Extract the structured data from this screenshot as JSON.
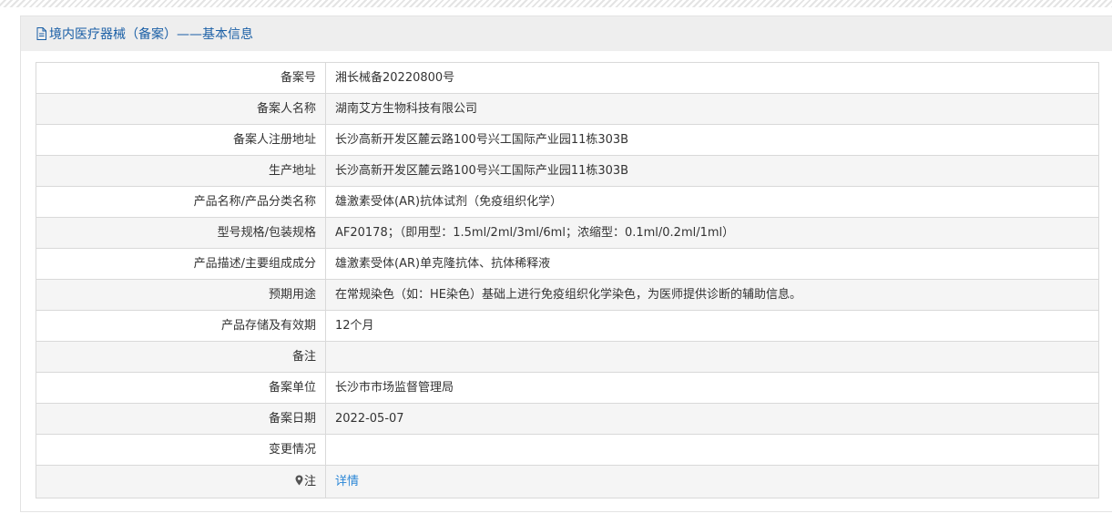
{
  "header": {
    "title": "境内医疗器械（备案）——基本信息",
    "icon": "document-icon"
  },
  "colors": {
    "header_text": "#1a5fa6",
    "link": "#2a86d6",
    "row_alt": "#f5f5f5"
  },
  "rows": [
    {
      "label": "备案号",
      "value": "湘长械备20220800号"
    },
    {
      "label": "备案人名称",
      "value": "湖南艾方生物科技有限公司"
    },
    {
      "label": "备案人注册地址",
      "value": "长沙高新开发区麓云路100号兴工国际产业园11栋303B"
    },
    {
      "label": "生产地址",
      "value": "长沙高新开发区麓云路100号兴工国际产业园11栋303B"
    },
    {
      "label": "产品名称/产品分类名称",
      "value": "雄激素受体(AR)抗体试剂（免疫组织化学）"
    },
    {
      "label": "型号规格/包装规格",
      "value": "AF20178；（即用型：1.5ml/2ml/3ml/6ml；浓缩型：0.1ml/0.2ml/1ml）"
    },
    {
      "label": "产品描述/主要组成成分",
      "value": "雄激素受体(AR)单克隆抗体、抗体稀释液"
    },
    {
      "label": "预期用途",
      "value": "在常规染色（如：HE染色）基础上进行免疫组织化学染色，为医师提供诊断的辅助信息。"
    },
    {
      "label": "产品存储及有效期",
      "value": "12个月"
    },
    {
      "label": "备注",
      "value": ""
    },
    {
      "label": "备案单位",
      "value": "长沙市市场监督管理局"
    },
    {
      "label": "备案日期",
      "value": "2022-05-07"
    },
    {
      "label": "变更情况",
      "value": ""
    }
  ],
  "note": {
    "label": "注",
    "icon": "pin-icon",
    "link_text": "详情"
  }
}
